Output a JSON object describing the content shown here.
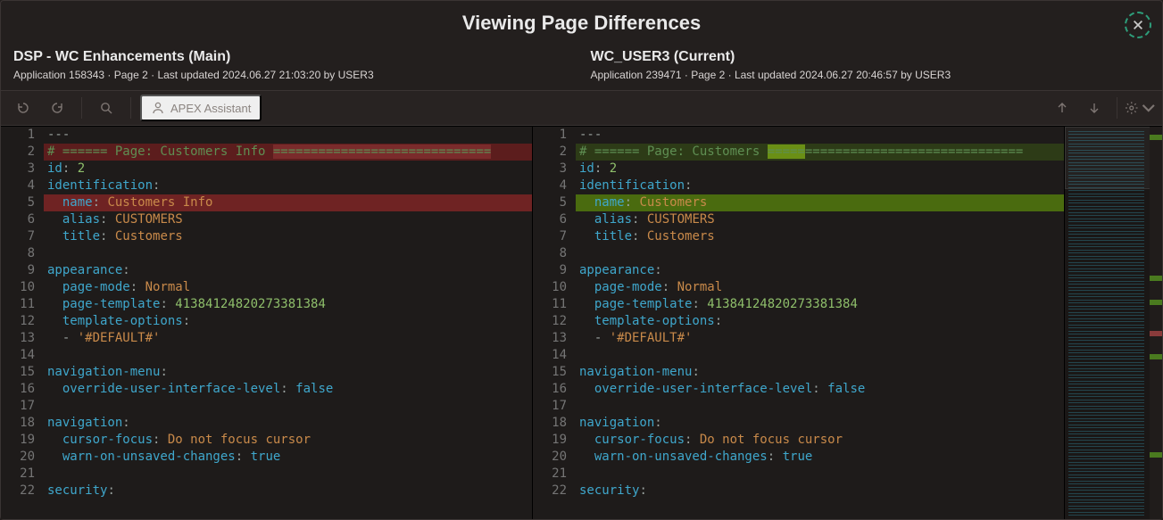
{
  "title": "Viewing Page Differences",
  "close_label": "Close",
  "toolbar": {
    "undo_label": "Undo",
    "redo_label": "Redo",
    "search_label": "Search",
    "apex_assistant_label": "APEX Assistant",
    "prev_diff_label": "Previous difference",
    "next_diff_label": "Next difference",
    "settings_label": "Settings"
  },
  "left": {
    "title": "DSP - WC Enhancements (Main)",
    "meta": "Application 158343 · Page 2 · Last updated 2024.06.27 21:03:20 by USER3",
    "lines": [
      {
        "n": 1,
        "type": "plain",
        "segments": [
          {
            "t": "---",
            "c": "punc"
          }
        ]
      },
      {
        "n": 2,
        "type": "removed",
        "marker": "-",
        "segments": [
          {
            "t": "# ====== Page: Customers Info ",
            "c": "cmt"
          },
          {
            "t": "=============================",
            "c": "cmt",
            "hl": "hl-del"
          }
        ]
      },
      {
        "n": 3,
        "type": "plain",
        "segments": [
          {
            "t": "id",
            "c": "key"
          },
          {
            "t": ": ",
            "c": "punc"
          },
          {
            "t": "2",
            "c": "num"
          }
        ]
      },
      {
        "n": 4,
        "type": "plain",
        "segments": [
          {
            "t": "identification",
            "c": "key"
          },
          {
            "t": ":",
            "c": "punc"
          }
        ]
      },
      {
        "n": 5,
        "type": "removed-strong",
        "marker": "-",
        "segments": [
          {
            "t": "  ",
            "c": "punc"
          },
          {
            "t": "name",
            "c": "key"
          },
          {
            "t": ": ",
            "c": "punc"
          },
          {
            "t": "Customers Info",
            "c": "str"
          }
        ]
      },
      {
        "n": 6,
        "type": "plain",
        "segments": [
          {
            "t": "  ",
            "c": "punc"
          },
          {
            "t": "alias",
            "c": "key"
          },
          {
            "t": ": ",
            "c": "punc"
          },
          {
            "t": "CUSTOMERS",
            "c": "str"
          }
        ]
      },
      {
        "n": 7,
        "type": "plain",
        "segments": [
          {
            "t": "  ",
            "c": "punc"
          },
          {
            "t": "title",
            "c": "key"
          },
          {
            "t": ": ",
            "c": "punc"
          },
          {
            "t": "Customers",
            "c": "str"
          }
        ]
      },
      {
        "n": 8,
        "type": "plain",
        "segments": [
          {
            "t": "",
            "c": "punc"
          }
        ]
      },
      {
        "n": 9,
        "type": "plain",
        "segments": [
          {
            "t": "appearance",
            "c": "key"
          },
          {
            "t": ":",
            "c": "punc"
          }
        ]
      },
      {
        "n": 10,
        "type": "plain",
        "segments": [
          {
            "t": "  ",
            "c": "punc"
          },
          {
            "t": "page-mode",
            "c": "key"
          },
          {
            "t": ": ",
            "c": "punc"
          },
          {
            "t": "Normal",
            "c": "str"
          }
        ]
      },
      {
        "n": 11,
        "type": "plain",
        "segments": [
          {
            "t": "  ",
            "c": "punc"
          },
          {
            "t": "page-template",
            "c": "key"
          },
          {
            "t": ": ",
            "c": "punc"
          },
          {
            "t": "41384124820273381384",
            "c": "num"
          }
        ]
      },
      {
        "n": 12,
        "type": "plain",
        "segments": [
          {
            "t": "  ",
            "c": "punc"
          },
          {
            "t": "template-options",
            "c": "key"
          },
          {
            "t": ":",
            "c": "punc"
          }
        ]
      },
      {
        "n": 13,
        "type": "plain",
        "segments": [
          {
            "t": "  - ",
            "c": "punc"
          },
          {
            "t": "'#DEFAULT#'",
            "c": "str"
          }
        ]
      },
      {
        "n": 14,
        "type": "plain",
        "segments": [
          {
            "t": "",
            "c": "punc"
          }
        ]
      },
      {
        "n": 15,
        "type": "plain",
        "segments": [
          {
            "t": "navigation-menu",
            "c": "key"
          },
          {
            "t": ":",
            "c": "punc"
          }
        ]
      },
      {
        "n": 16,
        "type": "plain",
        "segments": [
          {
            "t": "  ",
            "c": "punc"
          },
          {
            "t": "override-user-interface-level",
            "c": "key"
          },
          {
            "t": ": ",
            "c": "punc"
          },
          {
            "t": "false",
            "c": "bool"
          }
        ]
      },
      {
        "n": 17,
        "type": "plain",
        "segments": [
          {
            "t": "",
            "c": "punc"
          }
        ]
      },
      {
        "n": 18,
        "type": "plain",
        "segments": [
          {
            "t": "navigation",
            "c": "key"
          },
          {
            "t": ":",
            "c": "punc"
          }
        ]
      },
      {
        "n": 19,
        "type": "plain",
        "segments": [
          {
            "t": "  ",
            "c": "punc"
          },
          {
            "t": "cursor-focus",
            "c": "key"
          },
          {
            "t": ": ",
            "c": "punc"
          },
          {
            "t": "Do not focus cursor",
            "c": "str"
          }
        ]
      },
      {
        "n": 20,
        "type": "plain",
        "segments": [
          {
            "t": "  ",
            "c": "punc"
          },
          {
            "t": "warn-on-unsaved-changes",
            "c": "key"
          },
          {
            "t": ": ",
            "c": "punc"
          },
          {
            "t": "true",
            "c": "bool"
          }
        ]
      },
      {
        "n": 21,
        "type": "plain",
        "segments": [
          {
            "t": "",
            "c": "punc"
          }
        ]
      },
      {
        "n": 22,
        "type": "plain",
        "segments": [
          {
            "t": "security",
            "c": "key"
          },
          {
            "t": ":",
            "c": "punc"
          }
        ]
      }
    ]
  },
  "right": {
    "title": "WC_USER3 (Current)",
    "meta": "Application 239471 · Page 2 · Last updated 2024.06.27 20:46:57 by USER3",
    "lines": [
      {
        "n": 1,
        "type": "plain",
        "segments": [
          {
            "t": "---",
            "c": "punc"
          }
        ]
      },
      {
        "n": 2,
        "type": "added",
        "marker": "+",
        "segments": [
          {
            "t": "# ====== Page: Customers ",
            "c": "cmt"
          },
          {
            "t": "=====",
            "c": "cmt",
            "hl": "hl-add"
          },
          {
            "t": "=============================",
            "c": "cmt"
          }
        ]
      },
      {
        "n": 3,
        "type": "plain",
        "segments": [
          {
            "t": "id",
            "c": "key"
          },
          {
            "t": ": ",
            "c": "punc"
          },
          {
            "t": "2",
            "c": "num"
          }
        ]
      },
      {
        "n": 4,
        "type": "plain",
        "segments": [
          {
            "t": "identification",
            "c": "key"
          },
          {
            "t": ":",
            "c": "punc"
          }
        ]
      },
      {
        "n": 5,
        "type": "added-strong",
        "marker": "+",
        "segments": [
          {
            "t": "  ",
            "c": "punc"
          },
          {
            "t": "name",
            "c": "key"
          },
          {
            "t": ": ",
            "c": "punc"
          },
          {
            "t": "Customers",
            "c": "str"
          }
        ]
      },
      {
        "n": 6,
        "type": "plain",
        "segments": [
          {
            "t": "  ",
            "c": "punc"
          },
          {
            "t": "alias",
            "c": "key"
          },
          {
            "t": ": ",
            "c": "punc"
          },
          {
            "t": "CUSTOMERS",
            "c": "str"
          }
        ]
      },
      {
        "n": 7,
        "type": "plain",
        "segments": [
          {
            "t": "  ",
            "c": "punc"
          },
          {
            "t": "title",
            "c": "key"
          },
          {
            "t": ": ",
            "c": "punc"
          },
          {
            "t": "Customers",
            "c": "str"
          }
        ]
      },
      {
        "n": 8,
        "type": "plain",
        "segments": [
          {
            "t": "",
            "c": "punc"
          }
        ]
      },
      {
        "n": 9,
        "type": "plain",
        "segments": [
          {
            "t": "appearance",
            "c": "key"
          },
          {
            "t": ":",
            "c": "punc"
          }
        ]
      },
      {
        "n": 10,
        "type": "plain",
        "segments": [
          {
            "t": "  ",
            "c": "punc"
          },
          {
            "t": "page-mode",
            "c": "key"
          },
          {
            "t": ": ",
            "c": "punc"
          },
          {
            "t": "Normal",
            "c": "str"
          }
        ]
      },
      {
        "n": 11,
        "type": "plain",
        "segments": [
          {
            "t": "  ",
            "c": "punc"
          },
          {
            "t": "page-template",
            "c": "key"
          },
          {
            "t": ": ",
            "c": "punc"
          },
          {
            "t": "41384124820273381384",
            "c": "num"
          }
        ]
      },
      {
        "n": 12,
        "type": "plain",
        "segments": [
          {
            "t": "  ",
            "c": "punc"
          },
          {
            "t": "template-options",
            "c": "key"
          },
          {
            "t": ":",
            "c": "punc"
          }
        ]
      },
      {
        "n": 13,
        "type": "plain",
        "segments": [
          {
            "t": "  - ",
            "c": "punc"
          },
          {
            "t": "'#DEFAULT#'",
            "c": "str"
          }
        ]
      },
      {
        "n": 14,
        "type": "plain",
        "segments": [
          {
            "t": "",
            "c": "punc"
          }
        ]
      },
      {
        "n": 15,
        "type": "plain",
        "segments": [
          {
            "t": "navigation-menu",
            "c": "key"
          },
          {
            "t": ":",
            "c": "punc"
          }
        ]
      },
      {
        "n": 16,
        "type": "plain",
        "segments": [
          {
            "t": "  ",
            "c": "punc"
          },
          {
            "t": "override-user-interface-level",
            "c": "key"
          },
          {
            "t": ": ",
            "c": "punc"
          },
          {
            "t": "false",
            "c": "bool"
          }
        ]
      },
      {
        "n": 17,
        "type": "plain",
        "segments": [
          {
            "t": "",
            "c": "punc"
          }
        ]
      },
      {
        "n": 18,
        "type": "plain",
        "segments": [
          {
            "t": "navigation",
            "c": "key"
          },
          {
            "t": ":",
            "c": "punc"
          }
        ]
      },
      {
        "n": 19,
        "type": "plain",
        "segments": [
          {
            "t": "  ",
            "c": "punc"
          },
          {
            "t": "cursor-focus",
            "c": "key"
          },
          {
            "t": ": ",
            "c": "punc"
          },
          {
            "t": "Do not focus cursor",
            "c": "str"
          }
        ]
      },
      {
        "n": 20,
        "type": "plain",
        "segments": [
          {
            "t": "  ",
            "c": "punc"
          },
          {
            "t": "warn-on-unsaved-changes",
            "c": "key"
          },
          {
            "t": ": ",
            "c": "punc"
          },
          {
            "t": "true",
            "c": "bool"
          }
        ]
      },
      {
        "n": 21,
        "type": "plain",
        "segments": [
          {
            "t": "",
            "c": "punc"
          }
        ]
      },
      {
        "n": 22,
        "type": "plain",
        "segments": [
          {
            "t": "security",
            "c": "key"
          },
          {
            "t": ":",
            "c": "punc"
          }
        ]
      }
    ]
  },
  "minimap_bands": [
    {
      "pos": 2,
      "kind": "del"
    },
    {
      "pos": 2,
      "kind": "add"
    },
    {
      "pos": 38,
      "kind": "del"
    },
    {
      "pos": 38,
      "kind": "add"
    },
    {
      "pos": 44,
      "kind": "del"
    },
    {
      "pos": 44,
      "kind": "add"
    },
    {
      "pos": 52,
      "kind": "del"
    },
    {
      "pos": 58,
      "kind": "add"
    },
    {
      "pos": 83,
      "kind": "del"
    },
    {
      "pos": 83,
      "kind": "add"
    }
  ]
}
